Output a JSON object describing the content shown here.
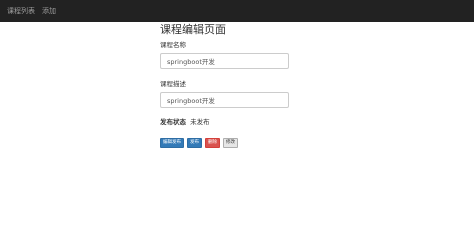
{
  "navbar": {
    "items": [
      {
        "label": "课程列表"
      },
      {
        "label": "添加"
      }
    ]
  },
  "page": {
    "title": "课程编辑页面"
  },
  "form": {
    "name_label": "课程名称",
    "name_value": "springboot开发",
    "desc_label": "课程描述",
    "desc_value": "springboot开发",
    "status_label": "发布状态",
    "status_value": "未发布"
  },
  "actions": {
    "edit_publish": "编辑发布",
    "publish": "发布",
    "delete": "删除",
    "modify": "修改"
  },
  "colors": {
    "navbar_bg": "#222222",
    "primary": "#337ab7",
    "danger": "#d9534f"
  }
}
